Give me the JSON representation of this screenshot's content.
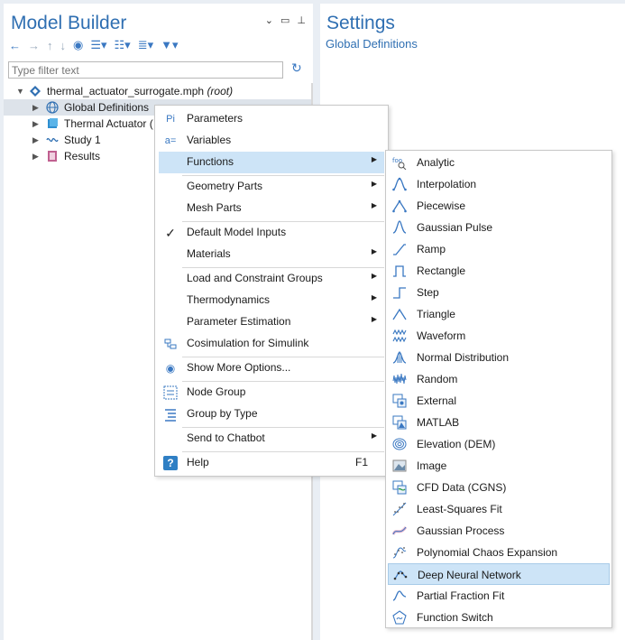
{
  "left_panel": {
    "title": "Model Builder",
    "filter_placeholder": "Type filter text",
    "tree": [
      {
        "label": "thermal_actuator_surrogate.mph",
        "suffix": "(root)"
      },
      {
        "label": "Global Definitions"
      },
      {
        "label": "Thermal Actuator ("
      },
      {
        "label": "Study 1"
      },
      {
        "label": "Results"
      }
    ]
  },
  "right_panel": {
    "title": "Settings",
    "subtitle": "Global Definitions"
  },
  "context_menu": {
    "items": [
      {
        "label": "Parameters"
      },
      {
        "label": "Variables"
      },
      {
        "label": "Functions"
      },
      {
        "label": "Geometry Parts"
      },
      {
        "label": "Mesh Parts"
      },
      {
        "label": "Default Model Inputs"
      },
      {
        "label": "Materials"
      },
      {
        "label": "Load and Constraint Groups"
      },
      {
        "label": "Thermodynamics"
      },
      {
        "label": "Parameter Estimation"
      },
      {
        "label": "Cosimulation for Simulink"
      },
      {
        "label": "Show More Options..."
      },
      {
        "label": "Node Group"
      },
      {
        "label": "Group by Type"
      },
      {
        "label": "Send to Chatbot"
      },
      {
        "label": "Help",
        "shortcut": "F1"
      }
    ],
    "icons": {
      "parameters": "Pi",
      "variables": "a="
    }
  },
  "functions_menu": {
    "items": [
      {
        "label": "Analytic",
        "icon": "foo"
      },
      {
        "label": "Interpolation"
      },
      {
        "label": "Piecewise"
      },
      {
        "label": "Gaussian Pulse"
      },
      {
        "label": "Ramp"
      },
      {
        "label": "Rectangle"
      },
      {
        "label": "Step"
      },
      {
        "label": "Triangle"
      },
      {
        "label": "Waveform"
      },
      {
        "label": "Normal Distribution"
      },
      {
        "label": "Random"
      },
      {
        "label": "External"
      },
      {
        "label": "MATLAB"
      },
      {
        "label": "Elevation (DEM)"
      },
      {
        "label": "Image"
      },
      {
        "label": "CFD Data (CGNS)"
      },
      {
        "label": "Least-Squares Fit"
      },
      {
        "label": "Gaussian Process"
      },
      {
        "label": "Polynomial Chaos Expansion"
      },
      {
        "label": "Deep Neural Network"
      },
      {
        "label": "Partial Fraction Fit"
      },
      {
        "label": "Function Switch"
      }
    ]
  },
  "colors": {
    "accent": "#2f6fb2",
    "highlight": "#cde4f7",
    "selected_tree": "#dde3ea"
  }
}
